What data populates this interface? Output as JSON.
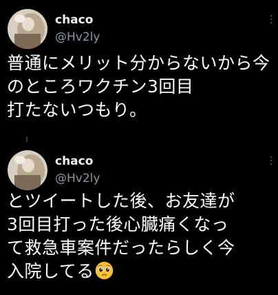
{
  "tweets": [
    {
      "username": "chaco",
      "handle": "@Hv2ly",
      "text": "普通にメリット分からないから今のところワクチン3回目\n打たないつもり。"
    },
    {
      "username": "chaco",
      "handle": "@Hv2ly",
      "text": "とツイートした後、お友達が\n3回目打った後心臓痛くなっ\nて救急車案件だったらしく今\n入院してる",
      "emoji": "pleading-face-icon"
    }
  ],
  "colors": {
    "background": "#000000",
    "text": "#ffffff",
    "handle": "#8b98a5",
    "emoji": "#f7c12f"
  }
}
